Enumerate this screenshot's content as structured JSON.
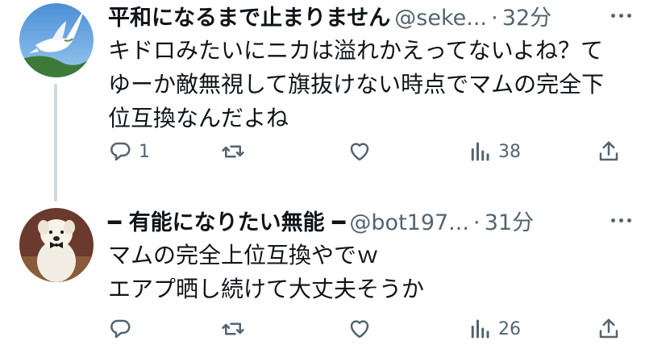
{
  "tweets": [
    {
      "display_name": "平和になるまで止まりません",
      "handle": "@seke...",
      "separator": "·",
      "time": "32分",
      "text": "キドロみたいにニカは溢れかえってないよね？て\nゆーか敵無視して旗抜けない時点でマムの完全下\n位互換なんだよね",
      "replies": "1",
      "retweets": "",
      "likes": "",
      "views": "38",
      "avatar": "white-dove-on-blue-sky"
    },
    {
      "display_name": "━ 有能になりたい無能 ━",
      "handle": "@bot197...",
      "separator": "·",
      "time": "31分",
      "text": "マムの完全上位互換やでｗ\nエアプ晒し続けて大丈夫そうか",
      "replies": "",
      "retweets": "",
      "likes": "",
      "views": "26",
      "avatar": "white-dog-with-bowtie"
    }
  ],
  "colors": {
    "text": "#0f1419",
    "muted": "#536471",
    "thread_line": "#cfd9de"
  }
}
